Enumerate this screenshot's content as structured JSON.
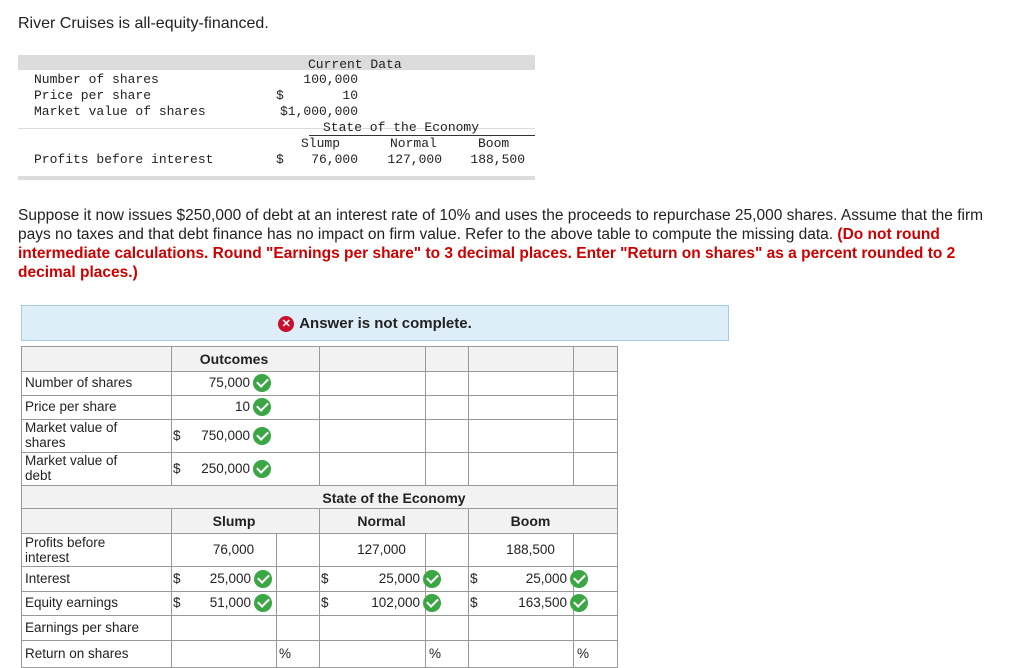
{
  "intro": "River Cruises is all-equity-financed.",
  "given_table": {
    "current_data_header": "Current Data",
    "rows": [
      {
        "label": "Number of shares",
        "symbol": "",
        "value": "100,000"
      },
      {
        "label": "Price per share",
        "symbol": "$",
        "value": "10"
      },
      {
        "label": "Market value of shares",
        "symbol": "",
        "value": "$1,000,000"
      }
    ],
    "state_header": "State of the Economy",
    "scenarios": [
      "Slump",
      "Normal",
      "Boom"
    ],
    "profits_label": "Profits before interest",
    "profits_symbol": "$",
    "profits": [
      "76,000",
      "127,000",
      "188,500"
    ]
  },
  "question": {
    "text": "Suppose it now issues $250,000 of debt at an interest rate of 10% and uses the proceeds to repurchase 25,000 shares. Assume that the firm pays no taxes and that debt finance has no impact on firm value. Refer to the above table to compute the missing data.",
    "instruction": "(Do not round intermediate calculations. Round \"Earnings per share\" to 3 decimal places. Enter \"Return on shares\" as a percent rounded to 2 decimal places.)"
  },
  "banner": {
    "text": "Answer is not complete.",
    "icon": "x-circle-icon",
    "color": "#c8102e"
  },
  "answer_table": {
    "outcomes_header": "Outcomes",
    "top_rows": [
      {
        "label_line1": "Number of shares",
        "label_line2": "",
        "symbol": "",
        "value": "75,000"
      },
      {
        "label_line1": "Price per share",
        "label_line2": "",
        "symbol": "",
        "value": "10"
      },
      {
        "label_line1": "Market value of",
        "label_line2": "shares",
        "symbol": "$",
        "value": "750,000"
      },
      {
        "label_line1": "Market value of",
        "label_line2": "debt",
        "symbol": "$",
        "value": "250,000"
      }
    ],
    "state_header": "State of the Economy",
    "scenarios": [
      "Slump",
      "Normal",
      "Boom"
    ],
    "profits": {
      "label_line1": "Profits before",
      "label_line2": "interest",
      "values": [
        "76,000",
        "127,000",
        "188,500"
      ]
    },
    "interest": {
      "label": "Interest",
      "symbol": "$",
      "values": [
        "25,000",
        "25,000",
        "25,000"
      ]
    },
    "equity": {
      "label": "Equity earnings",
      "symbol": "$",
      "values": [
        "51,000",
        "102,000",
        "163,500"
      ]
    },
    "eps": {
      "label": "Earnings per share",
      "values": [
        "",
        "",
        ""
      ]
    },
    "ros": {
      "label": "Return on shares",
      "values": [
        "",
        "",
        ""
      ],
      "unit": "%"
    },
    "correct_color": "#3aa644"
  }
}
